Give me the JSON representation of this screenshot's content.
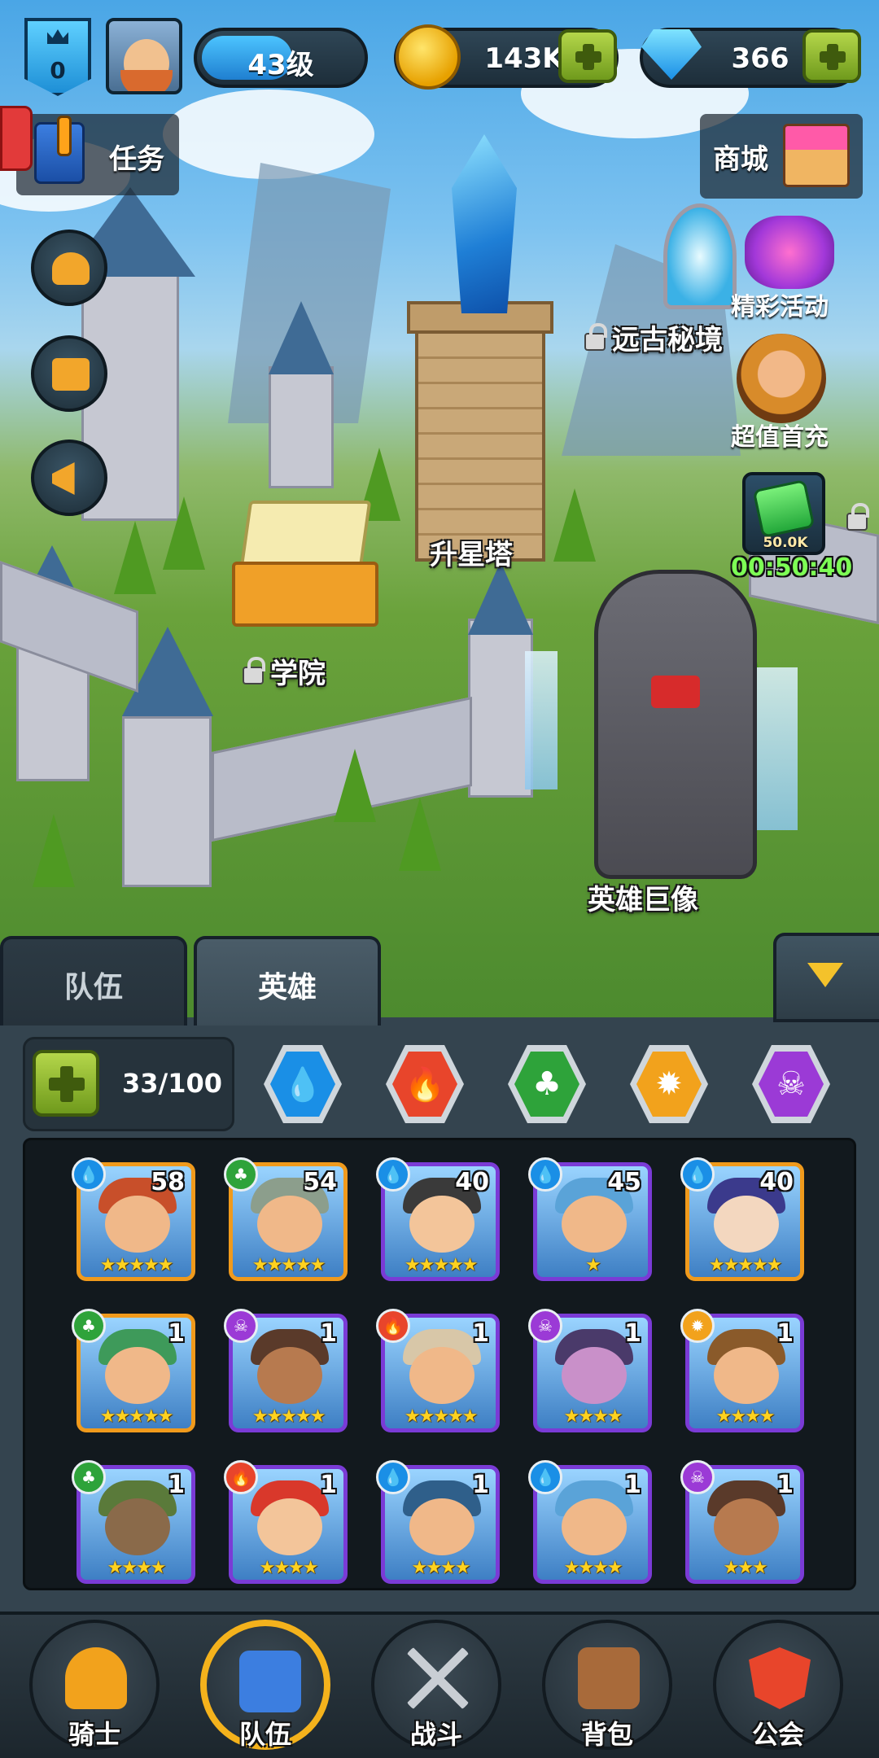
{
  "hud": {
    "rank": "0",
    "level_text": "43级",
    "level_progress": 0.55,
    "gold": "143K",
    "gems": "366"
  },
  "side_left": {
    "quest_label": "任务"
  },
  "side_right": {
    "shop_label": "商城",
    "event_label": "精彩活动",
    "first_recharge_label": "超值首充",
    "chest_caption": "50.0K",
    "timer": "00:50:40"
  },
  "map": {
    "ancient_realm": "远古秘境",
    "star_tower": "升星塔",
    "academy": "学院",
    "hero_statue": "英雄巨像"
  },
  "tabs": {
    "team": "队伍",
    "heroes": "英雄"
  },
  "hero_count": "33/100",
  "elements": [
    {
      "name": "water",
      "icon": "💧",
      "color": "#1a8fe6"
    },
    {
      "name": "fire",
      "icon": "🔥",
      "color": "#e8452b"
    },
    {
      "name": "nature",
      "icon": "♣",
      "color": "#2ea33a"
    },
    {
      "name": "light",
      "icon": "✹",
      "color": "#f2a21c"
    },
    {
      "name": "dark",
      "icon": "☠",
      "color": "#9b3ad6"
    }
  ],
  "heroes": [
    {
      "level": "58",
      "element": "water",
      "stars": "★★★★★",
      "frame": "gold",
      "skin": "#f0b889",
      "hat": "#c84f2a"
    },
    {
      "level": "54",
      "element": "nature",
      "stars": "★★★★★",
      "frame": "gold",
      "skin": "#f0b889",
      "hat": "#8c9e8c"
    },
    {
      "level": "40",
      "element": "water",
      "stars": "★★★★★",
      "frame": "purple",
      "skin": "#f3c59a",
      "hat": "#3a3a3a"
    },
    {
      "level": "45",
      "element": "water",
      "stars": "★",
      "frame": "purple",
      "skin": "#f0b889",
      "hat": "#5aa3d8"
    },
    {
      "level": "40",
      "element": "water",
      "stars": "★★★★★",
      "frame": "gold",
      "skin": "#f3d7bf",
      "hat": "#3b3a8c"
    },
    {
      "level": "1",
      "element": "nature",
      "stars": "★★★★★",
      "frame": "gold",
      "skin": "#f0b889",
      "hat": "#3e9a5a"
    },
    {
      "level": "1",
      "element": "dark",
      "stars": "★★★★★",
      "frame": "purple",
      "skin": "#b77a4f",
      "hat": "#5a3a2a"
    },
    {
      "level": "1",
      "element": "fire",
      "stars": "★★★★★",
      "frame": "purple",
      "skin": "#f0b889",
      "hat": "#d8c7a8"
    },
    {
      "level": "1",
      "element": "dark",
      "stars": "★★★★",
      "frame": "purple",
      "skin": "#c990c9",
      "hat": "#4a3a6a"
    },
    {
      "level": "1",
      "element": "light",
      "stars": "★★★★",
      "frame": "purple",
      "skin": "#f0b889",
      "hat": "#8a5a2a"
    },
    {
      "level": "1",
      "element": "nature",
      "stars": "★★★★",
      "frame": "purple",
      "skin": "#8a6a4a",
      "hat": "#5a7a3a"
    },
    {
      "level": "1",
      "element": "fire",
      "stars": "★★★★",
      "frame": "purple",
      "skin": "#f3c59a",
      "hat": "#d9382b"
    },
    {
      "level": "1",
      "element": "water",
      "stars": "★★★★",
      "frame": "purple",
      "skin": "#f0b889",
      "hat": "#2f5f8a"
    },
    {
      "level": "1",
      "element": "water",
      "stars": "★★★★",
      "frame": "purple",
      "skin": "#f0b889",
      "hat": "#5aa3d8"
    },
    {
      "level": "1",
      "element": "dark",
      "stars": "★★★",
      "frame": "purple",
      "skin": "#b77a4f",
      "hat": "#5a3a2a"
    }
  ],
  "nav": [
    {
      "label": "骑士",
      "icon": "knight-helmet-icon",
      "color": "#f2a21c"
    },
    {
      "label": "队伍",
      "icon": "team-banner-icon",
      "color": "#3c7ee0"
    },
    {
      "label": "战斗",
      "icon": "crossed-swords-icon",
      "color": "#c9ced4"
    },
    {
      "label": "背包",
      "icon": "backpack-chest-icon",
      "color": "#a86a3a"
    },
    {
      "label": "公会",
      "icon": "guild-shield-icon",
      "color": "#e8452b"
    }
  ]
}
